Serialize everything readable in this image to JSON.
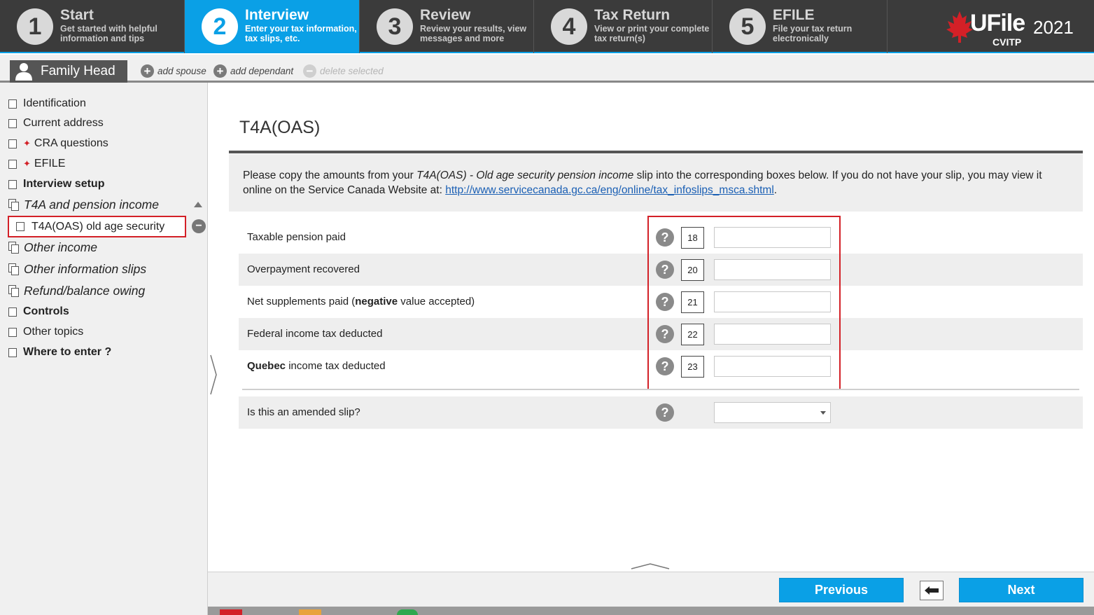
{
  "steps": [
    {
      "num": "1",
      "title": "Start",
      "subtitle1": "Get started with helpful",
      "subtitle2": "information and tips"
    },
    {
      "num": "2",
      "title": "Interview",
      "subtitle1": "Enter your tax information,",
      "subtitle2": "tax slips, etc."
    },
    {
      "num": "3",
      "title": "Review",
      "subtitle1": "Review your results, view",
      "subtitle2": "messages and more"
    },
    {
      "num": "4",
      "title": "Tax Return",
      "subtitle1": "View or print your complete",
      "subtitle2": "tax return(s)"
    },
    {
      "num": "5",
      "title": "EFILE",
      "subtitle1": "File your tax return",
      "subtitle2": "electronically"
    }
  ],
  "active_step": 2,
  "logo": {
    "brand": "UFile",
    "year": "2021",
    "edition": "CVITP"
  },
  "colors": {
    "accent": "#0aa0e6",
    "highlight_red": "#d32027",
    "dark_bar": "#3b3b3b"
  },
  "personbar": {
    "family_head": "Family Head",
    "add_spouse": "add spouse",
    "add_dependant": "add dependant",
    "delete_selected": "delete selected"
  },
  "sidebar": {
    "items": [
      {
        "label": "Identification"
      },
      {
        "label": "Current address"
      },
      {
        "label": "CRA questions"
      },
      {
        "label": "EFILE"
      },
      {
        "label": "Interview setup"
      },
      {
        "label": "T4A and pension income"
      },
      {
        "label": "T4A(OAS) old age security"
      },
      {
        "label": "Other income"
      },
      {
        "label": "Other information slips"
      },
      {
        "label": "Refund/balance owing"
      },
      {
        "label": "Controls"
      },
      {
        "label": "Other topics"
      },
      {
        "label": "Where to enter ?"
      }
    ]
  },
  "main": {
    "title": "T4A(OAS)",
    "intro_before": "Please copy the amounts from your ",
    "intro_italic": "T4A(OAS) - Old age security pension income",
    "intro_after": " slip into the corresponding boxes below. If you do not have your slip, you may view it online on the Service Canada Website at: ",
    "intro_link": "http://www.servicecanada.gc.ca/eng/online/tax_infoslips_msca.shtml",
    "intro_end": ".",
    "fields": [
      {
        "label": "Taxable pension paid",
        "box": "18",
        "value": ""
      },
      {
        "label_pre": "Net supplements paid (",
        "label_bold": "negative",
        "label_post": " value accepted)",
        "box": "21",
        "value": ""
      },
      {
        "label": "Overpayment recovered",
        "box": "20",
        "value": ""
      },
      {
        "label": "Federal income tax deducted",
        "box": "22",
        "value": ""
      },
      {
        "label_bold": "Quebec",
        "label_post": " income tax deducted",
        "box": "23",
        "value": ""
      }
    ],
    "amended_label": "Is this an amended slip?",
    "amended_value": ""
  },
  "footer": {
    "previous": "Previous",
    "next": "Next"
  }
}
